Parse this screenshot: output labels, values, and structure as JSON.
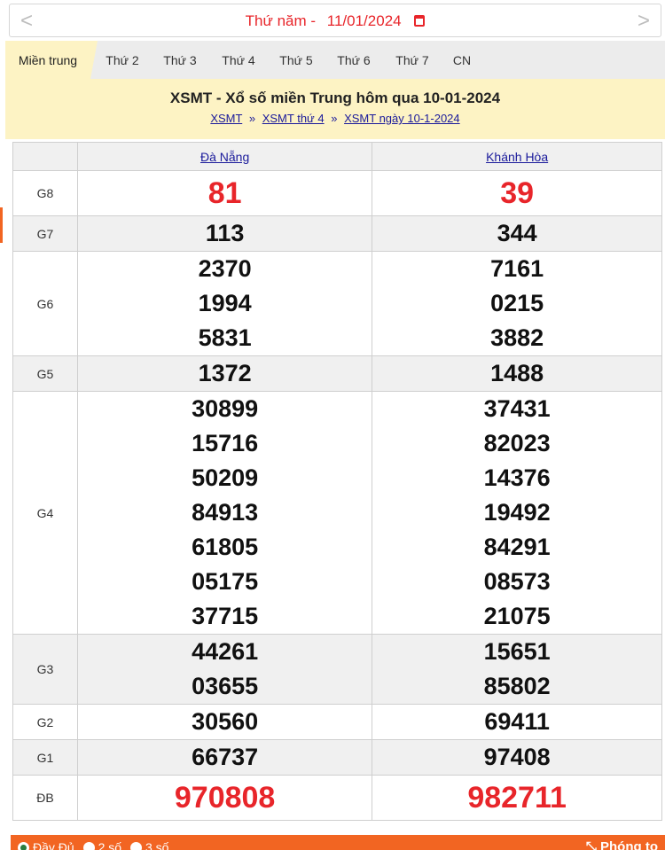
{
  "date_bar": {
    "prev": "<",
    "next": ">",
    "label": "Thứ năm -",
    "date": "11/01/2024"
  },
  "tabs": [
    "Miền trung",
    "Thứ 2",
    "Thứ 3",
    "Thứ 4",
    "Thứ 5",
    "Thứ 6",
    "Thứ 7",
    "CN"
  ],
  "header": {
    "title": "XSMT - Xổ số miền Trung hôm qua 10-01-2024",
    "crumbs": [
      "XSMT",
      "XSMT thứ 4",
      "XSMT ngày 10-1-2024"
    ],
    "separator": "»"
  },
  "columns": [
    "Đà Nẵng",
    "Khánh Hòa"
  ],
  "prizes": [
    {
      "label": "G8",
      "a": [
        "81"
      ],
      "b": [
        "39"
      ]
    },
    {
      "label": "G7",
      "a": [
        "113"
      ],
      "b": [
        "344"
      ]
    },
    {
      "label": "G6",
      "a": [
        "2370",
        "1994",
        "5831"
      ],
      "b": [
        "7161",
        "0215",
        "3882"
      ]
    },
    {
      "label": "G5",
      "a": [
        "1372"
      ],
      "b": [
        "1488"
      ]
    },
    {
      "label": "G4",
      "a": [
        "30899",
        "15716",
        "50209",
        "84913",
        "61805",
        "05175",
        "37715"
      ],
      "b": [
        "37431",
        "82023",
        "14376",
        "19492",
        "84291",
        "08573",
        "21075"
      ]
    },
    {
      "label": "G3",
      "a": [
        "44261",
        "03655"
      ],
      "b": [
        "15651",
        "85802"
      ]
    },
    {
      "label": "G2",
      "a": [
        "30560"
      ],
      "b": [
        "69411"
      ]
    },
    {
      "label": "G1",
      "a": [
        "66737"
      ],
      "b": [
        "97408"
      ]
    },
    {
      "label": "ĐB",
      "a": [
        "970808"
      ],
      "b": [
        "982711"
      ]
    }
  ],
  "bottom": {
    "options": [
      "Đầy Đủ",
      "2 số",
      "3 số"
    ],
    "selected": "Đầy Đủ",
    "zoom": "Phóng to",
    "zoom_icon": "expand-icon"
  },
  "colors": {
    "accent": "#f26522",
    "red": "#e8252a",
    "tab_active": "#fdf3c4",
    "link": "#1a1a9b"
  }
}
